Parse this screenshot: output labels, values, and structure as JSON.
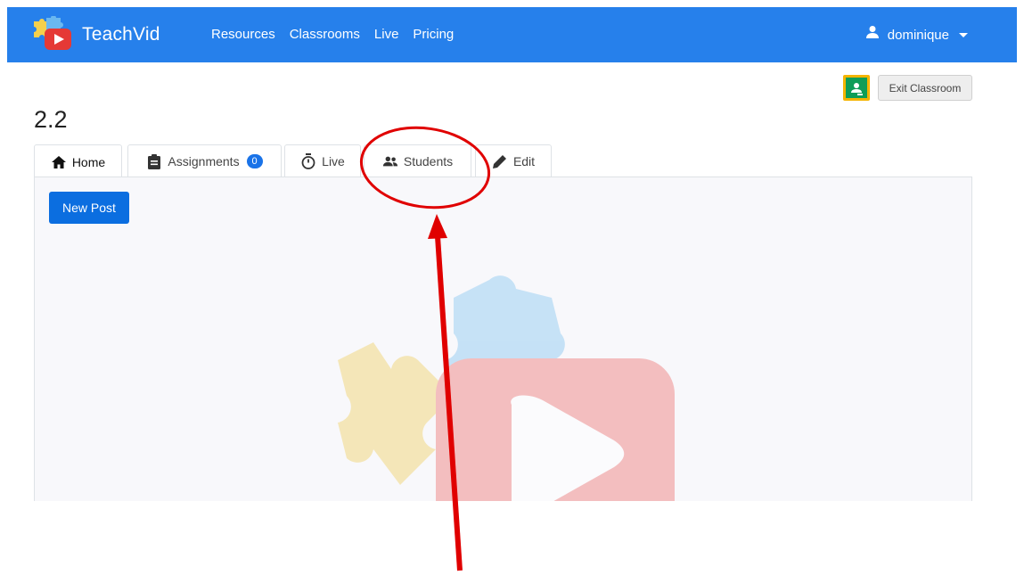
{
  "app": {
    "brand_name": "TeachVid",
    "colors": {
      "navbar": "#2680eb",
      "primary_button": "#0b6ee0",
      "badge": "#1a73e8",
      "annotation": "#e00000"
    }
  },
  "nav": {
    "links": [
      "Resources",
      "Classrooms",
      "Live",
      "Pricing"
    ],
    "user": "dominique"
  },
  "classroom": {
    "exit_label": "Exit Classroom",
    "title": "2.2"
  },
  "tabs": [
    {
      "label": "Home",
      "icon": "home-icon",
      "active": true
    },
    {
      "label": "Assignments",
      "icon": "clipboard-icon",
      "badge": "0"
    },
    {
      "label": "Live",
      "icon": "stopwatch-icon"
    },
    {
      "label": "Students",
      "icon": "users-icon"
    },
    {
      "label": "Edit",
      "icon": "pencil-icon"
    }
  ],
  "content": {
    "new_post_label": "New Post"
  }
}
